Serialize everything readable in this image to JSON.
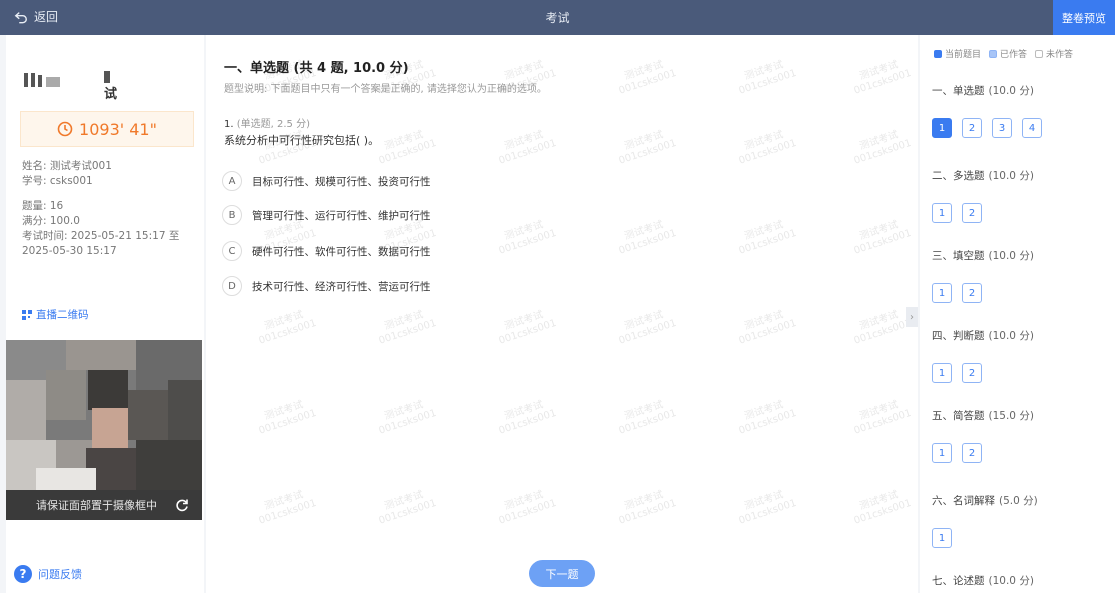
{
  "topbar": {
    "back_label": "返回",
    "title": "考试",
    "preview_label": "整卷预览"
  },
  "left": {
    "logo_char": "试",
    "timer": "1093' 41\"",
    "name": "姓名: 测试考试001",
    "student_id": "学号: csks001",
    "question_count": "题量: 16",
    "full_score": "满分: 100.0",
    "exam_time_line1": "考试时间: 2025-05-21 15:17 至",
    "exam_time_line2": "2025-05-30 15:17",
    "qr_link": "直播二维码",
    "camera_hint": "请保证面部置于摄像框中",
    "feedback": "问题反馈"
  },
  "main": {
    "section_title": "一、单选题 (共 4 题, 10.0 分)",
    "section_desc": "题型说明: 下面题目中只有一个答案是正确的, 请选择您认为正确的选项。",
    "question": {
      "number": "1.",
      "meta": "(单选题, 2.5 分)",
      "text": "系统分析中可行性研究包括(      )。",
      "options": [
        {
          "letter": "A",
          "text": "目标可行性、规模可行性、投资可行性"
        },
        {
          "letter": "B",
          "text": "管理可行性、运行可行性、维护可行性"
        },
        {
          "letter": "C",
          "text": "硬件可行性、软件可行性、数据可行性"
        },
        {
          "letter": "D",
          "text": "技术可行性、经济可行性、营运可行性"
        }
      ]
    },
    "next_label": "下一题",
    "watermark_line1": "测试考试",
    "watermark_line2": "001csks001"
  },
  "sheet": {
    "legend": [
      {
        "label": "当前题目",
        "color": "#3a7bf0"
      },
      {
        "label": "已作答",
        "color": "#a8c5f7"
      },
      {
        "label": "未作答",
        "color": "#ffffff"
      }
    ],
    "groups": [
      {
        "title": "一、单选题",
        "score": "(10.0 分)",
        "nums": [
          "1",
          "2",
          "3",
          "4"
        ]
      },
      {
        "title": "二、多选题",
        "score": "(10.0 分)",
        "nums": [
          "1",
          "2"
        ]
      },
      {
        "title": "三、填空题",
        "score": "(10.0 分)",
        "nums": [
          "1",
          "2"
        ]
      },
      {
        "title": "四、判断题",
        "score": "(10.0 分)",
        "nums": [
          "1",
          "2"
        ]
      },
      {
        "title": "五、简答题",
        "score": "(15.0 分)",
        "nums": [
          "1",
          "2"
        ]
      },
      {
        "title": "六、名词解释",
        "score": "(5.0 分)",
        "nums": [
          "1"
        ]
      },
      {
        "title": "七、论述题",
        "score": "(10.0 分)",
        "nums": []
      }
    ]
  }
}
